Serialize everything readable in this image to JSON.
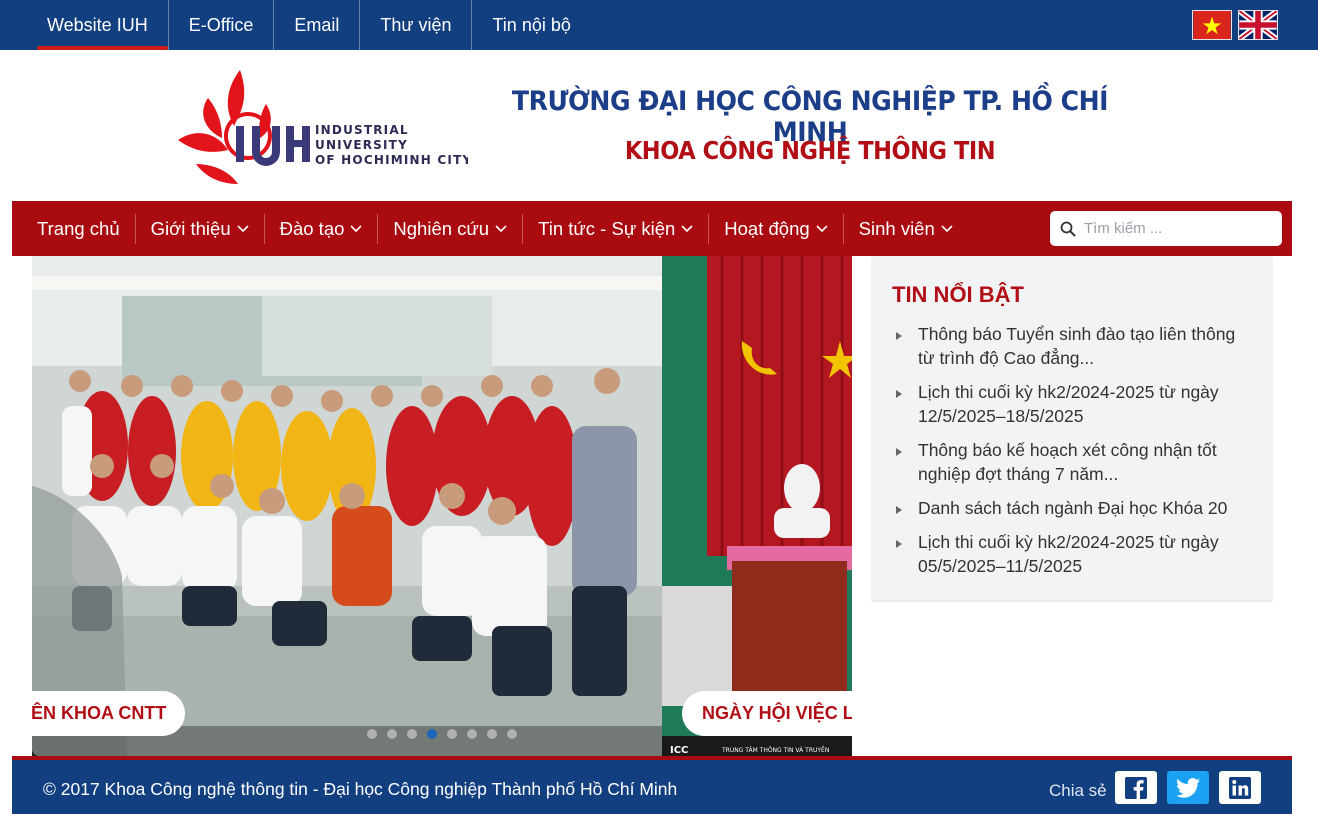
{
  "topbar": {
    "links": [
      "Website IUH",
      "E-Office",
      "Email",
      "Thư viện",
      "Tin nội bộ"
    ],
    "active": "Website IUH",
    "flags": [
      "vietnam-flag-icon",
      "uk-flag-icon"
    ]
  },
  "header": {
    "logo_letters": "IUH",
    "logo_text": [
      "INDUSTRIAL",
      "UNIVERSITY",
      "OF HOCHIMINH CITY"
    ],
    "title": "TRƯỜNG ĐẠI HỌC CÔNG NGHIỆP TP. HỒ CHÍ MINH",
    "subtitle": "KHOA CÔNG NGHỆ THÔNG TIN"
  },
  "nav": {
    "items": [
      {
        "label": "Trang chủ",
        "dropdown": false
      },
      {
        "label": "Giới thiệu",
        "dropdown": true
      },
      {
        "label": "Đào tạo",
        "dropdown": true
      },
      {
        "label": "Nghiên cứu",
        "dropdown": true
      },
      {
        "label": "Tin tức - Sự kiện",
        "dropdown": true
      },
      {
        "label": "Hoạt động",
        "dropdown": true
      },
      {
        "label": "Sinh viên",
        "dropdown": true
      }
    ],
    "search_placeholder": "Tìm kiếm ..."
  },
  "slider": {
    "captions": [
      "IÊN KHOA CNTT",
      "NGÀY HỘI VIỆC LÀ"
    ],
    "slide2_sign": "TRUNG TÂM THÔNG TIN VÀ TRUYỀN",
    "dot_count": 8,
    "active_dot": 4
  },
  "featured": {
    "title": "TIN NỔI BẬT",
    "items": [
      "Thông báo Tuyển sinh đào tạo liên thông từ trình độ Cao đẳng...",
      "Lịch thi cuối kỳ hk2/2024-2025 từ ngày 12/5/2025–18/5/2025",
      "Thông báo kế hoạch xét công nhận tốt nghiệp đợt tháng 7 năm...",
      "Danh sách tách ngành Đại học Khóa 20",
      "Lịch thi cuối kỳ hk2/2024-2025 từ ngày 05/5/2025–11/5/2025"
    ]
  },
  "footer": {
    "copyright": "© 2017 Khoa Công nghệ thông tin - Đại học Công nghiệp Thành phố Hồ Chí Minh",
    "share_label": "Chia sẻ",
    "social": [
      "facebook-icon",
      "twitter-icon",
      "linkedin-icon"
    ]
  },
  "colors": {
    "topbar": "#123f80",
    "nav": "#a90b10",
    "accent_red": "#b10e16",
    "title_blue": "#1c3d87",
    "twitter": "#1da1f2"
  }
}
